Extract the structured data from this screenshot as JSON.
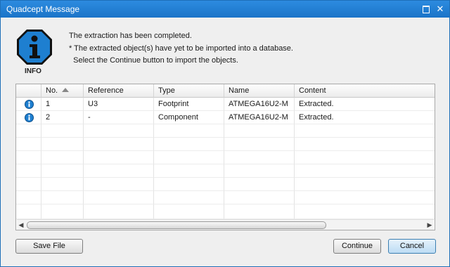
{
  "window": {
    "title": "Quadcept Message"
  },
  "message": {
    "icon": "info-octagon-icon",
    "icon_label": "INFO",
    "lines": [
      "The extraction has been completed.",
      "* The extracted object(s) have yet to be imported into a database.",
      "  Select the Continue button to import the objects."
    ]
  },
  "table": {
    "columns": [
      "",
      "No.",
      "Reference",
      "Type",
      "Name",
      "Content"
    ],
    "sort_column": "No.",
    "sort_direction": "ascending",
    "rows": [
      {
        "icon": "info-icon",
        "no": "1",
        "reference": "U3",
        "type": "Footprint",
        "name": "ATMEGA16U2-M",
        "content": "Extracted."
      },
      {
        "icon": "info-icon",
        "no": "2",
        "reference": "-",
        "type": "Component",
        "name": "ATMEGA16U2-M",
        "content": "Extracted."
      }
    ]
  },
  "buttons": {
    "save_file": "Save File",
    "continue": "Continue",
    "cancel": "Cancel"
  },
  "colors": {
    "titlebar": "#1a74c8",
    "info_icon_fill": "#1e7fd0",
    "cancel_border": "#3c7fb1"
  }
}
